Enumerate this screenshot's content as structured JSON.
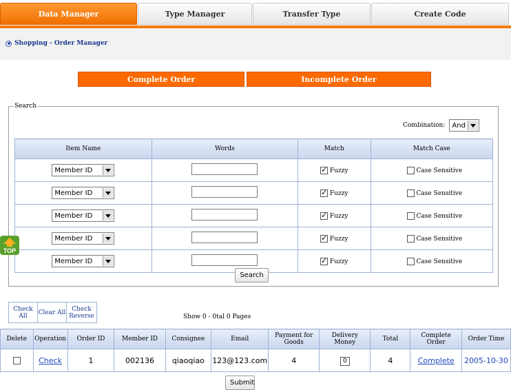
{
  "tabs": [
    "Data Manager",
    "Type Manager",
    "Transfer Type",
    "Create Code"
  ],
  "breadcrumb": "Shopping - Order Manager",
  "order_buttons": {
    "complete": "Complete Order",
    "incomplete": "Incomplete Order"
  },
  "search": {
    "legend": "Search",
    "combination_label": "Combination:",
    "combination_value": "And",
    "headers": [
      "Item Name",
      "Words",
      "Match",
      "Match Case"
    ],
    "rows": [
      {
        "item": "Member ID",
        "words": "",
        "fuzzy": "Fuzzy",
        "case": "Case Sensitive"
      },
      {
        "item": "Member ID",
        "words": "",
        "fuzzy": "Fuzzy",
        "case": "Case Sensitive"
      },
      {
        "item": "Member ID",
        "words": "",
        "fuzzy": "Fuzzy",
        "case": "Case Sensitive"
      },
      {
        "item": "Member ID",
        "words": "",
        "fuzzy": "Fuzzy",
        "case": "Case Sensitive"
      },
      {
        "item": "Member ID",
        "words": "",
        "fuzzy": "Fuzzy",
        "case": "Case Sensitive"
      }
    ],
    "search_button": "Search"
  },
  "top_badge": "TOP",
  "bulk": {
    "check_all": "Check All",
    "clear_all": "Clear All",
    "check_reverse": "Check Reverse"
  },
  "show_info": "Show 0 - 0tal 0 Pages",
  "results": {
    "headers": [
      "Delete",
      "Operation",
      "Order ID",
      "Member ID",
      "Consignee",
      "Email",
      "Payment for Goods",
      "Delivery Money",
      "Total",
      "Complete Order",
      "Order Time"
    ],
    "rows": [
      {
        "operation": "Check",
        "order_id": "1",
        "member_id": "002136",
        "consignee": "qiaoqiao",
        "email": "123@123.com",
        "payment": "4",
        "delivery": "0",
        "total": "4",
        "complete": "Complete",
        "time": "2005-10-30"
      }
    ]
  },
  "submit": "Submit"
}
